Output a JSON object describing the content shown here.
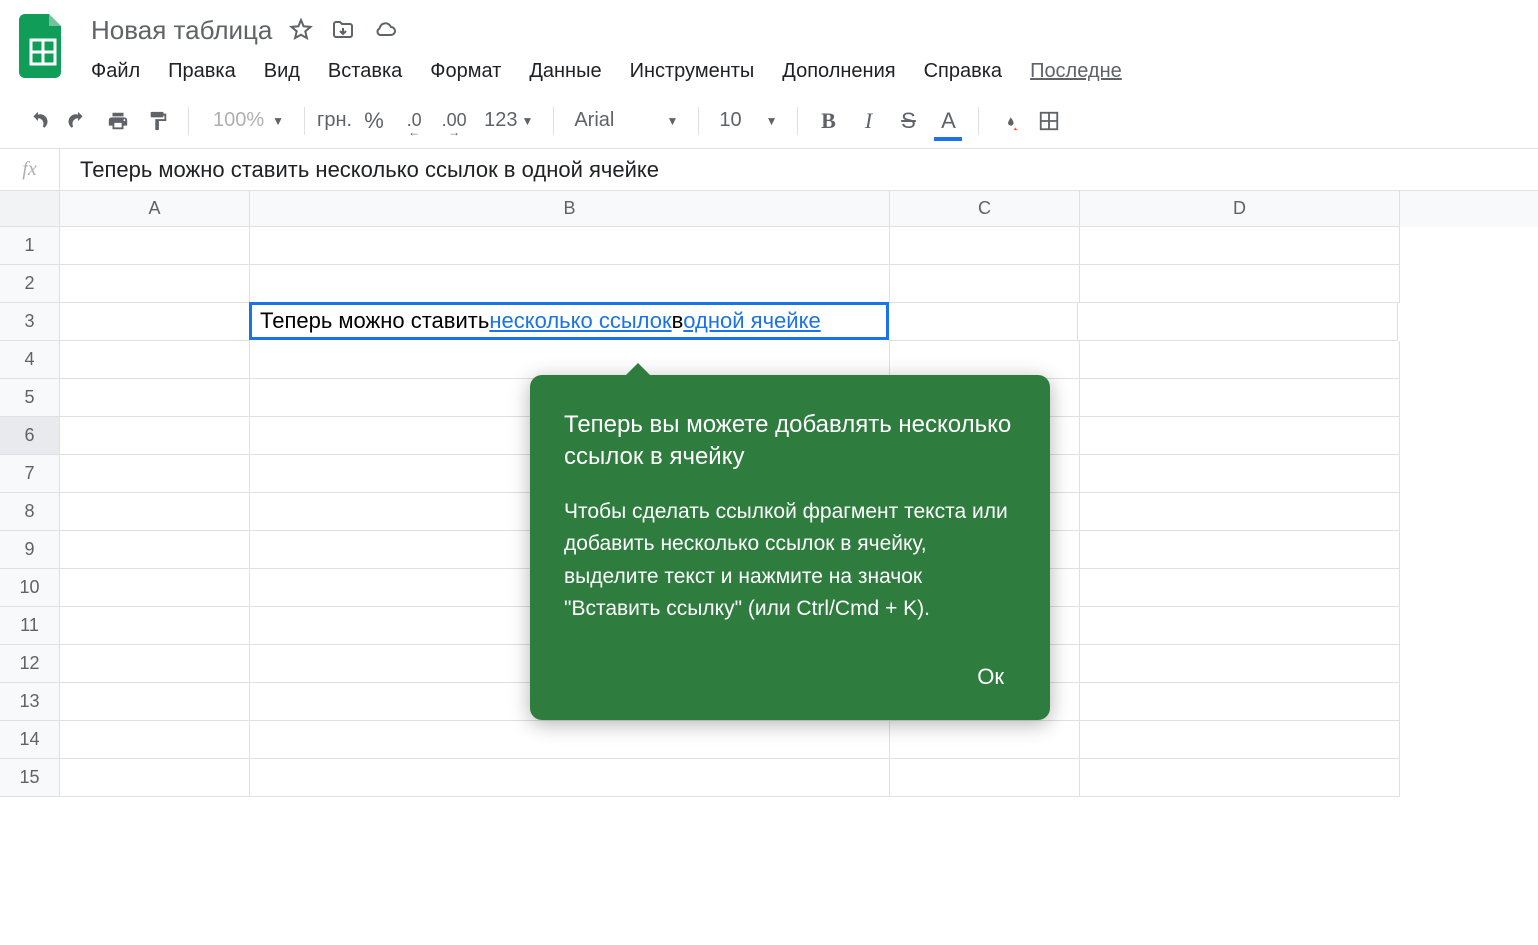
{
  "header": {
    "doc_title": "Новая таблица"
  },
  "menu": {
    "file": "Файл",
    "edit": "Правка",
    "view": "Вид",
    "insert": "Вставка",
    "format": "Формат",
    "data": "Данные",
    "tools": "Инструменты",
    "addons": "Дополнения",
    "help": "Справка",
    "last": "Последне"
  },
  "toolbar": {
    "zoom": "100%",
    "currency": "грн.",
    "percent": "%",
    "dec_dec": ".0",
    "inc_dec": ".00",
    "num_fmt": "123",
    "font": "Arial",
    "font_size": "10",
    "bold": "B",
    "italic": "I",
    "strike": "S",
    "text_color": "A"
  },
  "formula": {
    "fx": "fx",
    "value": "Теперь можно ставить несколько ссылок в одной ячейке"
  },
  "columns": [
    "A",
    "B",
    "C",
    "D"
  ],
  "rows": [
    "1",
    "2",
    "3",
    "4",
    "5",
    "6",
    "7",
    "8",
    "9",
    "10",
    "11",
    "12",
    "13",
    "14",
    "15"
  ],
  "active_cell": {
    "text_before": "Теперь можно ставить ",
    "link1": "несколько ссылок",
    "text_mid": " в ",
    "link2": "одной ячейке"
  },
  "promo": {
    "title": "Теперь вы можете добавлять несколько ссылок в ячейку",
    "body": "Чтобы сделать ссылкой фрагмент текста или добавить несколько ссылок в ячейку, выделите текст и нажмите на значок \"Вставить ссылку\" (или Ctrl/Cmd + K).",
    "ok": "Ок"
  }
}
